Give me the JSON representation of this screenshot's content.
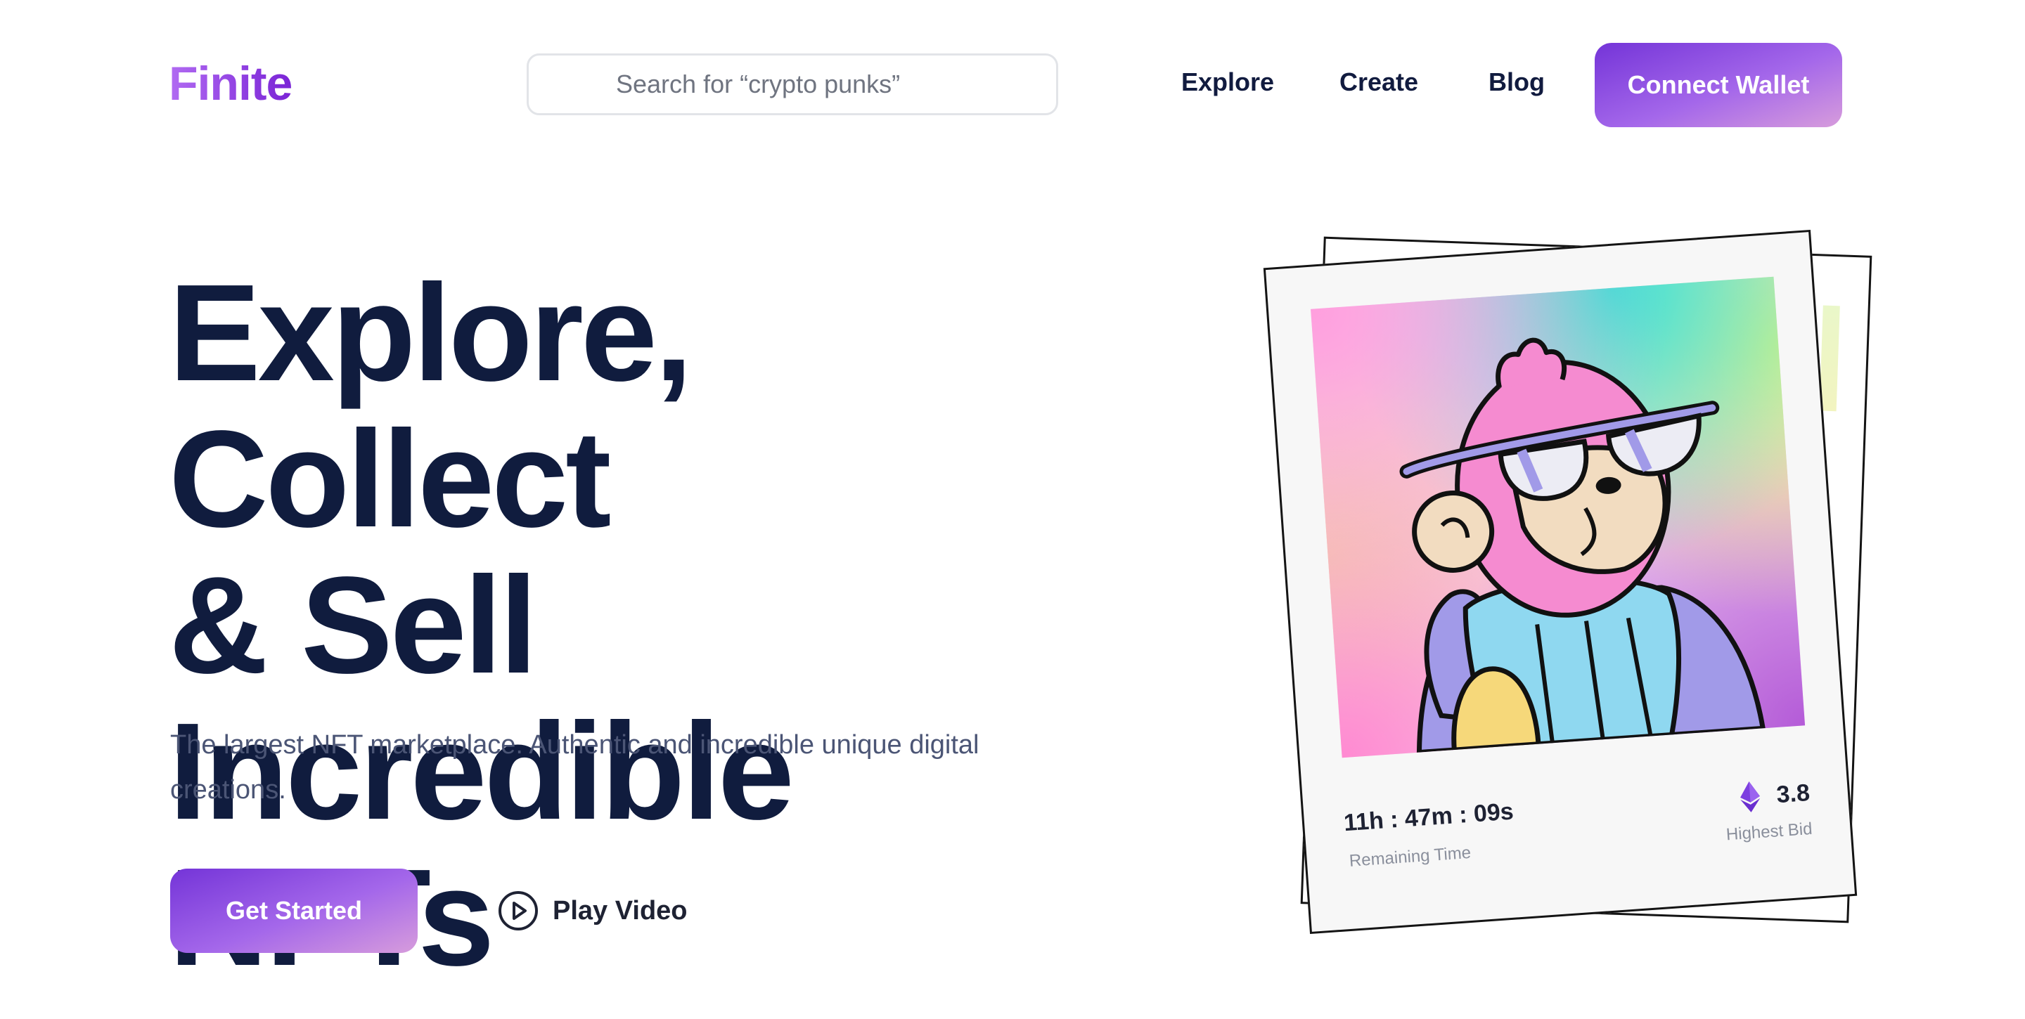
{
  "header": {
    "logo": "Finite",
    "search": {
      "placeholder": "Search for “crypto punks”",
      "value": ""
    },
    "nav": [
      {
        "label": "Explore"
      },
      {
        "label": "Create"
      },
      {
        "label": "Blog"
      }
    ],
    "connect_wallet_label": "Connect Wallet"
  },
  "hero": {
    "title_lines": [
      "Explore, Collect",
      "& Sell Incredible",
      "NFTs"
    ],
    "subtitle": "The largest NFT marketplace. Authentic and incredible unique digital creations.",
    "get_started_label": "Get Started",
    "play_video_label": "Play Video",
    "play_icon": "play-circle-icon"
  },
  "nft_card": {
    "artwork": "monkey-with-sunglasses-illustration",
    "remaining_time": "11h : 47m : 09s",
    "remaining_time_label": "Remaining Time",
    "highest_bid": "3.8",
    "highest_bid_label": "Highest Bid",
    "currency_icon": "ethereum-icon"
  },
  "colors": {
    "brand_purple": "#7a24d6",
    "button_gradient_start": "#7434d8",
    "button_gradient_end": "#d79cdc",
    "heading_navy": "#101c3e",
    "body_text": "#4b5575"
  }
}
